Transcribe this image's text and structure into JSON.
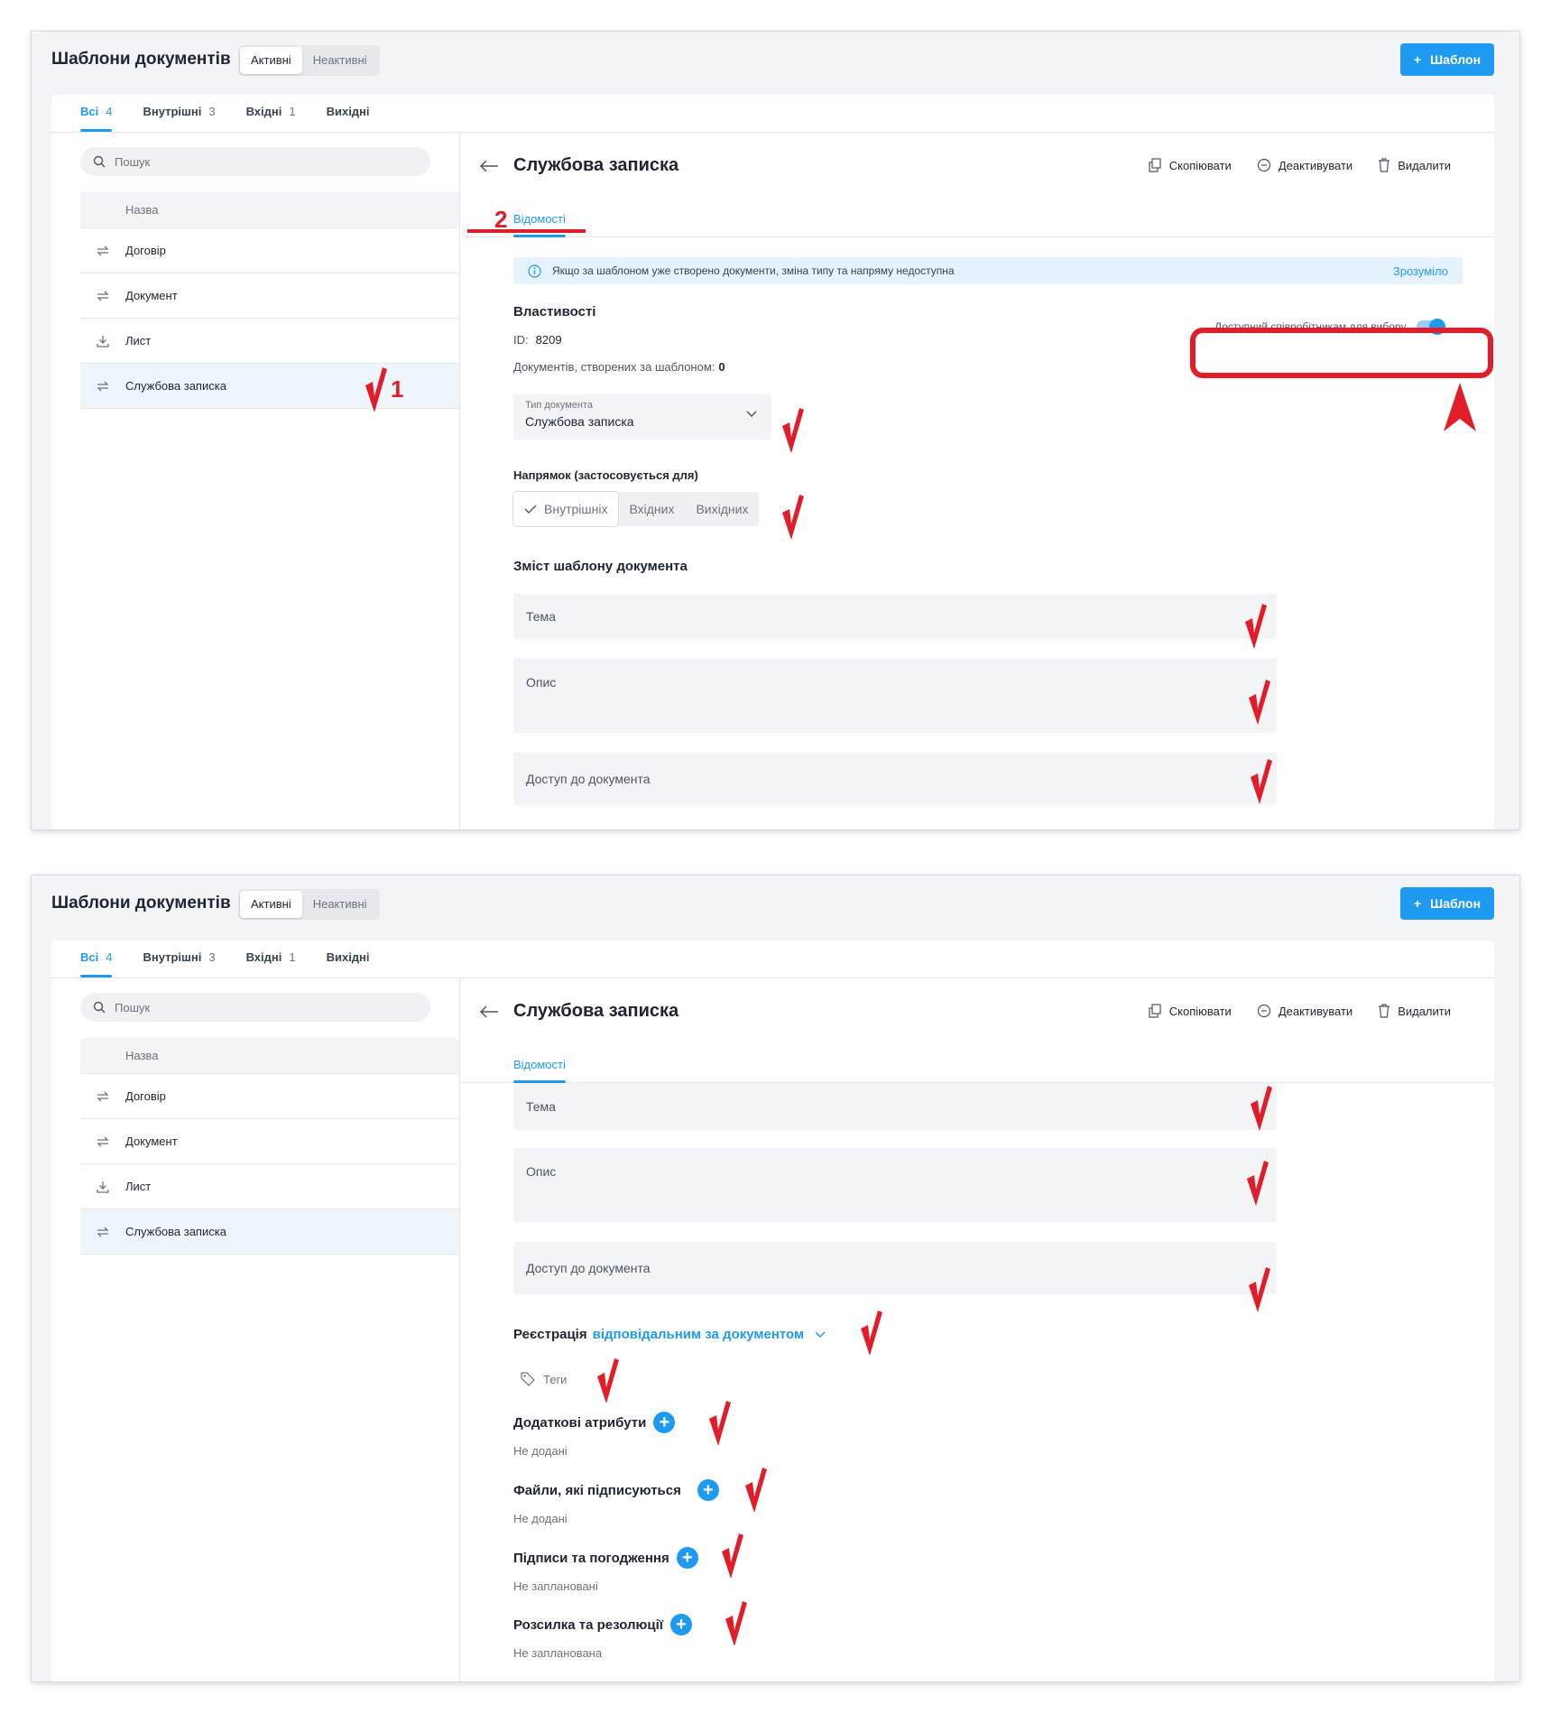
{
  "app": {
    "title": "Шаблони документів",
    "segment": {
      "active": "Активні",
      "inactive": "Неактивні"
    },
    "add_button": "Шаблон"
  },
  "filter_tabs": [
    {
      "label": "Всі",
      "count": "4"
    },
    {
      "label": "Внутрішні",
      "count": "3"
    },
    {
      "label": "Вхідні",
      "count": "1"
    },
    {
      "label": "Вихідні",
      "count": ""
    }
  ],
  "search": {
    "placeholder": "Пошук"
  },
  "list": {
    "header": "Назва",
    "items": [
      {
        "label": "Договір",
        "icon": "swap-icon"
      },
      {
        "label": "Документ",
        "icon": "swap-icon"
      },
      {
        "label": "Лист",
        "icon": "download-icon"
      },
      {
        "label": "Службова записка",
        "icon": "swap-icon",
        "selected": true
      }
    ]
  },
  "detail": {
    "title": "Службова записка",
    "actions": {
      "copy": "Скопіювати",
      "deactivate": "Деактивувати",
      "delete": "Видалити"
    },
    "tab": "Відомості",
    "info": {
      "text": "Якщо за шаблоном уже створено документи, зміна типу та напряму недоступна",
      "ok": "Зрозуміло"
    },
    "properties": {
      "heading": "Властивості",
      "id_label": "ID:",
      "id_value": "8209",
      "docs_label": "Документів, створених за шаблоном:",
      "docs_value": "0",
      "toggle_label": "Доступний співробітникам для вибору",
      "toggle_on": true
    },
    "doc_type": {
      "label": "Тип документа",
      "value": "Службова записка"
    },
    "direction": {
      "heading": "Напрямок (застосовується для)",
      "options": [
        "Внутрішніх",
        "Вхідних",
        "Вихідних"
      ],
      "selected": "Внутрішніх"
    },
    "content": {
      "heading": "Зміст шаблону документа",
      "fields": {
        "topic": "Тема",
        "description": "Опис",
        "access": "Доступ до документа"
      }
    },
    "registration": {
      "label": "Реєстрація",
      "link": "відповідальним за документом"
    },
    "tags": "Теги",
    "sections": [
      {
        "title": "Додаткові атрибути",
        "status": "Не додані"
      },
      {
        "title": "Файли, які підписуються",
        "status": "Не додані"
      },
      {
        "title": "Підписи та погодження",
        "status": "Не заплановані"
      },
      {
        "title": "Розсилка та резолюції",
        "status": "Не запланована"
      }
    ]
  },
  "annotations": {
    "marker_1": "1",
    "marker_2": "2",
    "accent_color": "#e11d2a"
  },
  "colors": {
    "primary": "#1e9bf0",
    "background": "#f3f4f6",
    "selected_row": "#eef6fc",
    "info_bg": "#e7f3fc"
  }
}
